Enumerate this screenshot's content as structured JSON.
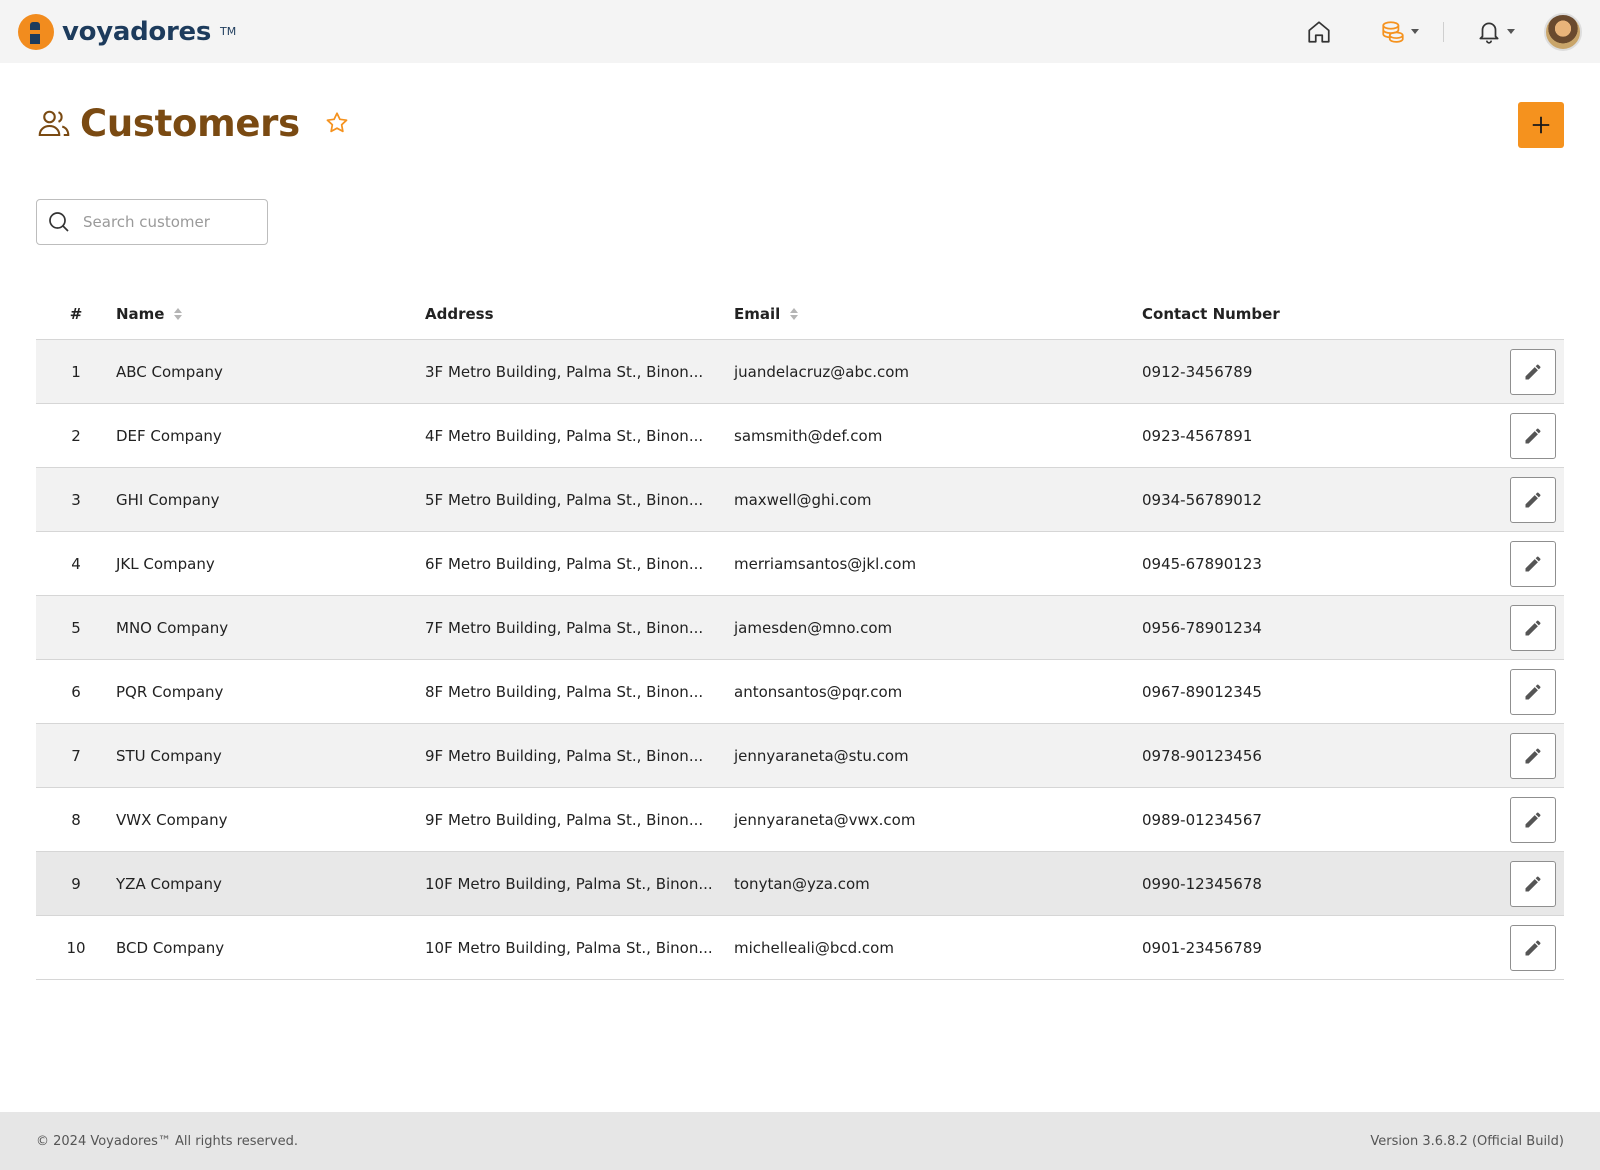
{
  "brand": {
    "name": "voyadores",
    "tm": "TM"
  },
  "header": {
    "title": "Customers"
  },
  "search": {
    "placeholder": "Search customer"
  },
  "table": {
    "columns": {
      "num": "#",
      "name": "Name",
      "address": "Address",
      "email": "Email",
      "contact": "Contact Number"
    },
    "rows": [
      {
        "num": "1",
        "name": "ABC Company",
        "address": "3F Metro Building, Palma St., Binon...",
        "email": "juandelacruz@abc.com",
        "contact": "0912-3456789"
      },
      {
        "num": "2",
        "name": "DEF Company",
        "address": "4F Metro Building, Palma St., Binon...",
        "email": "samsmith@def.com",
        "contact": "0923-4567891"
      },
      {
        "num": "3",
        "name": "GHI Company",
        "address": "5F Metro Building, Palma St., Binon...",
        "email": "maxwell@ghi.com",
        "contact": "0934-56789012"
      },
      {
        "num": "4",
        "name": "JKL Company",
        "address": "6F Metro Building, Palma St., Binon...",
        "email": "merriamsantos@jkl.com",
        "contact": "0945-67890123"
      },
      {
        "num": "5",
        "name": "MNO Company",
        "address": "7F Metro Building, Palma St., Binon...",
        "email": "jamesden@mno.com",
        "contact": "0956-78901234"
      },
      {
        "num": "6",
        "name": "PQR Company",
        "address": "8F Metro Building, Palma St., Binon...",
        "email": "antonsantos@pqr.com",
        "contact": "0967-89012345"
      },
      {
        "num": "7",
        "name": "STU Company",
        "address": "9F Metro Building, Palma St., Binon...",
        "email": "jennyaraneta@stu.com",
        "contact": "0978-90123456"
      },
      {
        "num": "8",
        "name": "VWX Company",
        "address": "9F Metro Building, Palma St., Binon...",
        "email": "jennyaraneta@vwx.com",
        "contact": "0989-01234567"
      },
      {
        "num": "9",
        "name": "YZA Company",
        "address": "10F Metro Building, Palma St., Binon...",
        "email": "tonytan@yza.com",
        "contact": "0990-12345678"
      },
      {
        "num": "10",
        "name": "BCD Company",
        "address": "10F Metro Building, Palma St., Binon...",
        "email": "michelleali@bcd.com",
        "contact": "0901-23456789"
      }
    ]
  },
  "footer": {
    "copyright": "© 2024 Voyadores™ All rights reserved.",
    "version": "Version 3.6.8.2 (Official Build)"
  },
  "colors": {
    "accent": "#f5921e",
    "title": "#7a4a12",
    "brand": "#1d3b5c"
  },
  "icons": [
    "lighthouse-logo-icon",
    "home-icon",
    "coins-icon",
    "bell-icon",
    "customers-icon",
    "star-icon",
    "plus-icon",
    "search-icon",
    "pencil-icon",
    "sort-icon"
  ]
}
